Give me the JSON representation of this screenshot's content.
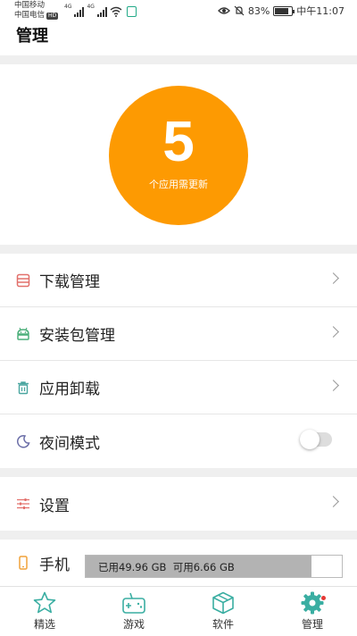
{
  "status_bar": {
    "carrier_1": "中国移动",
    "carrier_2": "中国电信",
    "hd": "HD",
    "net_1": "4G",
    "net_2": "4G",
    "battery": "83%",
    "battery_level": 0.83,
    "time": "中午11:07"
  },
  "header": {
    "title": "管理"
  },
  "updates": {
    "count": "5",
    "label": "个应用需更新",
    "color": "#fd9a02"
  },
  "menu": [
    {
      "label": "下载管理",
      "icon": "download-list-icon"
    },
    {
      "label": "安装包管理",
      "icon": "android-icon"
    },
    {
      "label": "应用卸载",
      "icon": "trash-icon"
    },
    {
      "label": "夜间模式",
      "icon": "moon-icon",
      "toggle": false
    }
  ],
  "settings": {
    "label": "设置",
    "icon": "sliders-icon"
  },
  "storage": {
    "label": "手机",
    "icon": "phone-icon",
    "used_text": "已用49.96 GB",
    "free_text": "可用6.66 GB",
    "used_fraction": 0.88
  },
  "tabs": [
    {
      "label": "精选",
      "icon": "star-icon"
    },
    {
      "label": "游戏",
      "icon": "gamepad-icon"
    },
    {
      "label": "软件",
      "icon": "box-icon"
    },
    {
      "label": "管理",
      "icon": "gear-icon",
      "active": true
    }
  ]
}
